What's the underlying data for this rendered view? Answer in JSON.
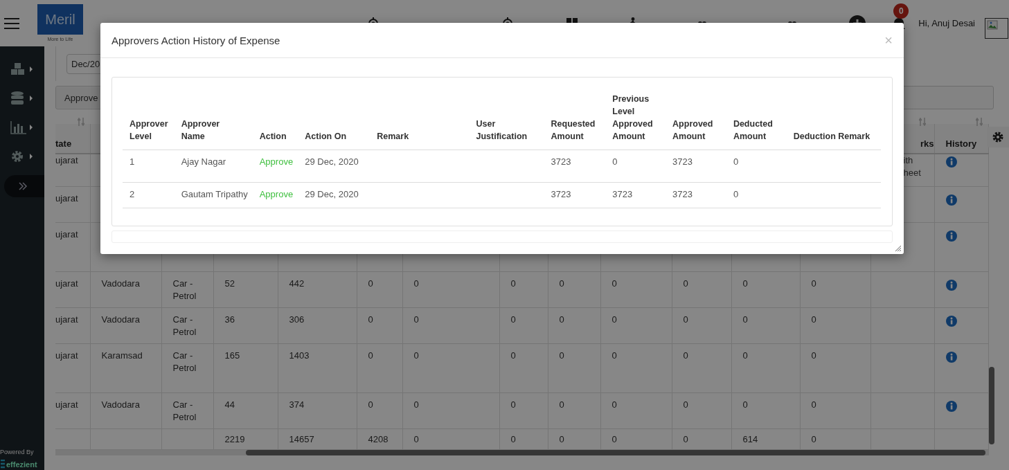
{
  "header": {
    "logo": "Meril",
    "tagline": "More to Life",
    "nav": [
      {
        "kind": "target"
      },
      {
        "kind": "target"
      },
      {
        "kind": "grid"
      },
      {
        "kind": "walk"
      },
      {
        "kind": "dots"
      },
      {
        "kind": "dots"
      }
    ],
    "notification_count": "0",
    "greeting": "Hi, Anuj Desai"
  },
  "sidebar": {
    "powered_by": "Powered By",
    "brand": "effezient"
  },
  "filters": {
    "month": "Dec/20",
    "approve_button": "Approve"
  },
  "table": {
    "header": {
      "column_1": "tate",
      "column_14": "rks",
      "column_15": "History"
    },
    "rows": [
      {
        "cells": [
          "ujarat"
        ],
        "remarks": "ith\nheet",
        "history_icon": true
      },
      {
        "cells": [
          "ujarat"
        ],
        "history_icon": true
      },
      {
        "cells": [
          "ujarat"
        ],
        "history_icon": true
      },
      {
        "cells": [
          "ujarat",
          "Vadodara",
          "Car - Petrol",
          "52",
          "442",
          "0",
          "0",
          "0",
          "0",
          "0",
          "0",
          "0",
          "0"
        ],
        "history_icon": true
      },
      {
        "cells": [
          "ujarat",
          "Vadodara",
          "Car - Petrol",
          "36",
          "306",
          "0",
          "0",
          "0",
          "0",
          "0",
          "0",
          "0",
          "0"
        ],
        "history_icon": true
      },
      {
        "cells": [
          "ujarat",
          "Karamsad",
          "Car - Petrol",
          "165",
          "1403",
          "0",
          "0",
          "0",
          "0",
          "0",
          "0",
          "0",
          "0"
        ],
        "history_icon": true
      },
      {
        "cells": [
          "ujarat",
          "Vadodara",
          "Car - Petrol",
          "44",
          "374",
          "0",
          "0",
          "0",
          "0",
          "0",
          "0",
          "0",
          "0"
        ],
        "history_icon": true
      },
      {
        "cells": [
          "",
          "",
          "",
          "2219",
          "14657",
          "4208",
          "0",
          "0",
          "0",
          "0",
          "0",
          "614",
          "0"
        ],
        "history_icon": false
      }
    ]
  },
  "modal": {
    "title": "Approvers Action History of Expense",
    "close": "×",
    "columns": [
      "Approver Level",
      "Approver Name",
      "Action",
      "Action On",
      "Remark",
      "User Justification",
      "Requested Amount",
      "Previous Level Approved Amount",
      "Approved Amount",
      "Deducted Amount",
      "Deduction Remark"
    ],
    "rows": [
      {
        "level": "1",
        "name": "Ajay Nagar",
        "action": "Approve",
        "action_on": "29 Dec, 2020",
        "requested": "3723",
        "previous": "0",
        "approved": "3723",
        "deducted": "0"
      },
      {
        "level": "2",
        "name": "Gautam Tripathy",
        "action": "Approve",
        "action_on": "29 Dec, 2020",
        "requested": "3723",
        "previous": "3723",
        "approved": "3723",
        "deducted": "0"
      }
    ]
  }
}
